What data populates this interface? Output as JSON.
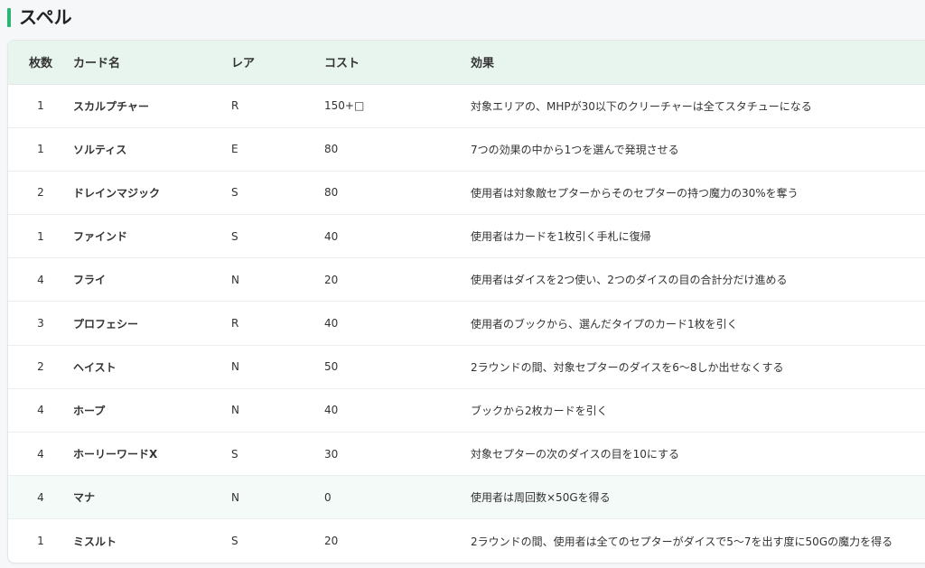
{
  "section": {
    "title": "スペル",
    "accent_color": "#2bb673"
  },
  "table": {
    "headers": {
      "count": "枚数",
      "name": "カード名",
      "rarity": "レア",
      "cost": "コスト",
      "effect": "効果"
    },
    "rows": [
      {
        "count": "1",
        "name": "スカルプチャー",
        "rarity": "R",
        "cost": "150+□",
        "effect": "対象エリアの、MHPが30以下のクリーチャーは全てスタチューになる"
      },
      {
        "count": "1",
        "name": "ソルティス",
        "rarity": "E",
        "cost": "80",
        "effect": "7つの効果の中から1つを選んで発現させる"
      },
      {
        "count": "2",
        "name": "ドレインマジック",
        "rarity": "S",
        "cost": "80",
        "effect": "使用者は対象敵セプターからそのセプターの持つ魔力の30%を奪う"
      },
      {
        "count": "1",
        "name": "ファインド",
        "rarity": "S",
        "cost": "40",
        "effect": "使用者はカードを1枚引く手札に復帰"
      },
      {
        "count": "4",
        "name": "フライ",
        "rarity": "N",
        "cost": "20",
        "effect": "使用者はダイスを2つ使い、2つのダイスの目の合計分だけ進める"
      },
      {
        "count": "3",
        "name": "プロフェシー",
        "rarity": "R",
        "cost": "40",
        "effect": "使用者のブックから、選んだタイプのカード1枚を引く"
      },
      {
        "count": "2",
        "name": "ヘイスト",
        "rarity": "N",
        "cost": "50",
        "effect": "2ラウンドの間、対象セプターのダイスを6～8しか出せなくする"
      },
      {
        "count": "4",
        "name": "ホープ",
        "rarity": "N",
        "cost": "40",
        "effect": "ブックから2枚カードを引く"
      },
      {
        "count": "4",
        "name": "ホーリーワードX",
        "rarity": "S",
        "cost": "30",
        "effect": "対象セプターの次のダイスの目を10にする"
      },
      {
        "count": "4",
        "name": "マナ",
        "rarity": "N",
        "cost": "0",
        "effect": "使用者は周回数×50Gを得る"
      },
      {
        "count": "1",
        "name": "ミスルト",
        "rarity": "S",
        "cost": "20",
        "effect": "2ラウンドの間、使用者は全てのセプターがダイスで5～7を出す度に50Gの魔力を得る"
      }
    ]
  }
}
